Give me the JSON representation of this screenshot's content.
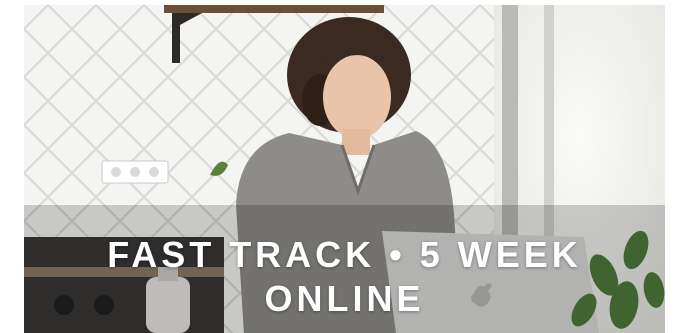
{
  "hero": {
    "title_line1": "FAST TRACK • 5 WEEK",
    "title_line2": "ONLINE",
    "image": "woman-working-on-laptop-in-kitchen",
    "text_color": "#ffffff"
  }
}
